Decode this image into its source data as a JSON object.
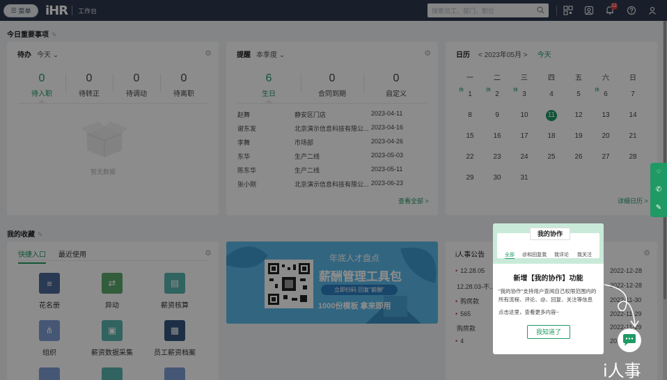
{
  "topbar": {
    "menu_label": "菜单",
    "logo_text": "iHR",
    "workspace_label": "工作台",
    "search_placeholder": "搜索员工、部门、职位",
    "notification_count": "12"
  },
  "today": {
    "section_title": "今日重要事项",
    "todo": {
      "title": "待办",
      "filter": "今天",
      "stats": [
        {
          "label": "待入职",
          "value": "0"
        },
        {
          "label": "待转正",
          "value": "0"
        },
        {
          "label": "待调动",
          "value": "0"
        },
        {
          "label": "待离职",
          "value": "0"
        }
      ],
      "empty_text": "暂无数据"
    },
    "reminder": {
      "title": "提醒",
      "filter": "本季度",
      "stats": [
        {
          "label": "生日",
          "value": "6"
        },
        {
          "label": "合同到期",
          "value": "0"
        },
        {
          "label": "自定义",
          "value": "0"
        }
      ],
      "rows": [
        {
          "name": "赵舞",
          "dept": "静安区门店",
          "date": "2023-04-11"
        },
        {
          "name": "谢东发",
          "dept": "北京演示信息科技有限公...",
          "date": "2023-04-16"
        },
        {
          "name": "李舞",
          "dept": "市场部",
          "date": "2023-04-26"
        },
        {
          "name": "东华",
          "dept": "生产二线",
          "date": "2023-05-03"
        },
        {
          "name": "陈东华",
          "dept": "生产二线",
          "date": "2023-05-11"
        },
        {
          "name": "张小刚",
          "dept": "北京演示信息科技有限公...",
          "date": "2023-06-23"
        }
      ],
      "view_all": "查看全部 >"
    },
    "calendar": {
      "title": "日历",
      "month": "< 2023年05月 >",
      "today_label": "今天",
      "weekdays": [
        "一",
        "二",
        "三",
        "四",
        "五",
        "六",
        "日"
      ],
      "weeks": [
        [
          "1",
          "2",
          "3",
          "4",
          "5",
          "6",
          "7"
        ],
        [
          "8",
          "9",
          "10",
          "11",
          "12",
          "13",
          "14"
        ],
        [
          "15",
          "16",
          "17",
          "18",
          "19",
          "20",
          "21"
        ],
        [
          "22",
          "23",
          "24",
          "25",
          "26",
          "27",
          "28"
        ],
        [
          "29",
          "30",
          "31"
        ]
      ],
      "holiday_tag": "休",
      "detail_link": "详细日历 >"
    }
  },
  "favorites": {
    "section_title": "我的收藏",
    "tabs": [
      "快捷入口",
      "最近使用"
    ],
    "items": [
      {
        "label": "花名册",
        "color": "#4e6a9a"
      },
      {
        "label": "异动",
        "color": "#5aaa6a"
      },
      {
        "label": "薪资核算",
        "color": "#5ab4b0"
      },
      {
        "label": "组织",
        "color": "#7e9ed6"
      },
      {
        "label": "薪资数据采集",
        "color": "#5ab4b0"
      },
      {
        "label": "员工薪资档案",
        "color": "#33577f"
      }
    ],
    "banner": {
      "title": "年底人才盘点",
      "headline": "薪酬管理工具包",
      "cta": "立即扫码 回复\"薪酬\"",
      "sub": "1000份模板 拿来即用"
    }
  },
  "announcements": {
    "title": "i人事公告",
    "rows": [
      {
        "text": "12.28.05",
        "date": "2022-12-28",
        "dot": true
      },
      {
        "text": "12.28.03-不...",
        "date": "2022-12-28",
        "dot": false
      },
      {
        "text": "购房款",
        "date": "2022-11-30",
        "dot": true
      },
      {
        "text": "565",
        "date": "2022-11-29",
        "dot": true
      },
      {
        "text": "购房款",
        "date": "2022-11-29",
        "dot": false
      },
      {
        "text": "4",
        "date": "2022-11-29",
        "dot": true
      }
    ]
  },
  "popup": {
    "title": "我的协作",
    "tabs": [
      "全部",
      "@和回复我",
      "我评论",
      "我关注"
    ],
    "heading": "新增【我的协作】功能",
    "body": "\"我的协作\"支持用户查阅自己权限范围内的所有流程、评论、@、回复、关注等信息",
    "body2": "点击这里，查看更多内容~",
    "button": "我知道了"
  },
  "watermark": "i人事",
  "colors": {
    "accent": "#1f9a64",
    "topbar": "#2c3a4e"
  }
}
